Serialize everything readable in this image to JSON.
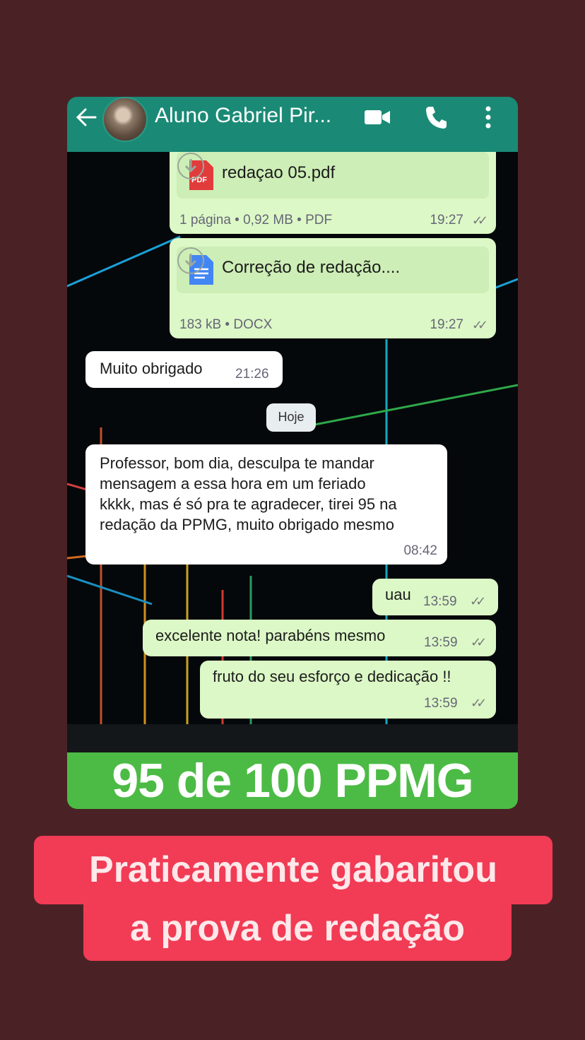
{
  "header": {
    "contact_name": "Aluno Gabriel Pir...",
    "icons": [
      "back-arrow-icon",
      "avatar",
      "video-call-icon",
      "phone-icon",
      "more-vert-icon"
    ]
  },
  "messages": {
    "doc1": {
      "name": "redaçao 05.pdf",
      "meta": "1 página • 0,92 MB • PDF",
      "time": "19:27",
      "type_label": "PDF"
    },
    "doc2": {
      "name": "Correção de redação....",
      "meta": "183 kB • DOCX",
      "time": "19:27"
    },
    "in1": {
      "text": "Muito obrigado",
      "time": "21:26"
    },
    "date_chip": "Hoje",
    "in2": {
      "line1": "Professor, bom dia, desculpa te mandar",
      "line2": "mensagem a essa hora em um feriado",
      "line3": "kkkk, mas é só pra te agradecer, tirei 95 na",
      "line4": "redação da PPMG, muito obrigado mesmo",
      "time": "08:42"
    },
    "out1": {
      "text": "uau",
      "time": "13:59"
    },
    "out2": {
      "text": "excelente nota! parabéns mesmo",
      "time": "13:59"
    },
    "out3": {
      "text": "fruto do seu esforço e dedicação !!",
      "time": "13:59"
    },
    "ticks": "✓✓"
  },
  "banner": "95 de 100 PPMG",
  "caption": {
    "line1": "Praticamente gabaritou",
    "line2": "a prova de redação"
  },
  "colors": {
    "page_bg": "#4a2226",
    "header": "#1a8a76",
    "outgoing": "#dcf8c6",
    "banner": "#4cbb45",
    "caption": "#f23b55"
  }
}
